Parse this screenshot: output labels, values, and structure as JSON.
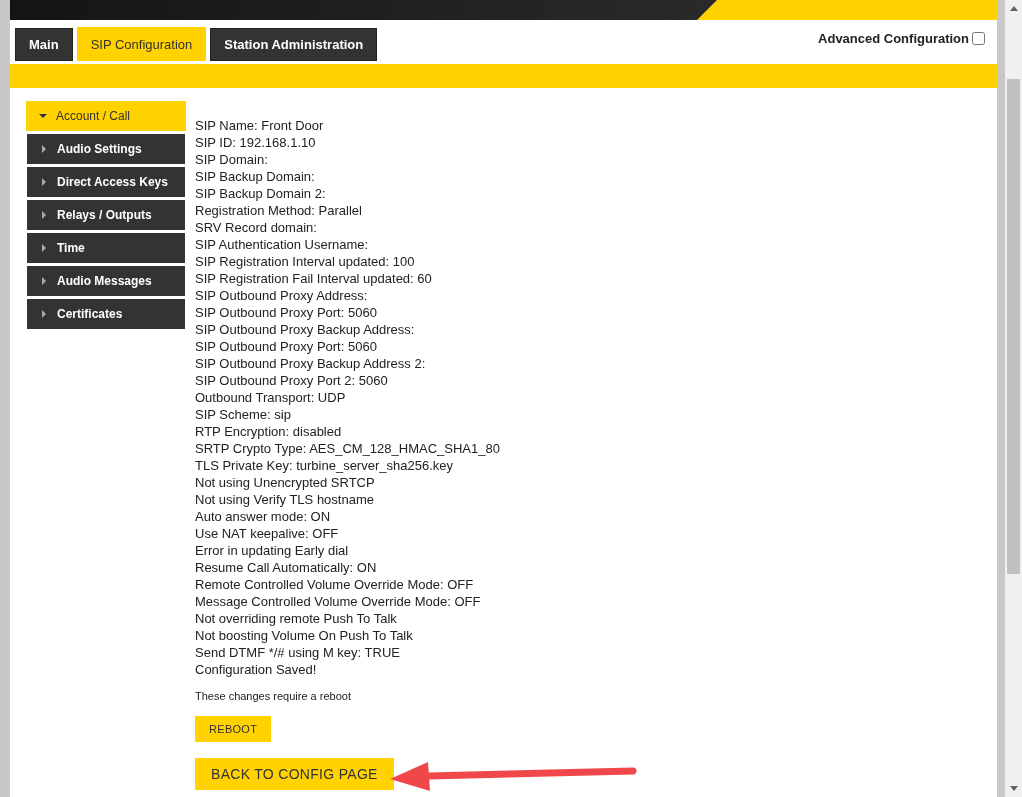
{
  "tabs": [
    {
      "label": "Main",
      "selected": false
    },
    {
      "label": "SIP Configuration",
      "selected": true
    },
    {
      "label": "Station Administration",
      "selected": false
    }
  ],
  "advanced_configuration": {
    "label": "Advanced Configuration",
    "checked": false
  },
  "sidebar": {
    "items": [
      {
        "label": "Account / Call",
        "expanded": true,
        "selected": true
      },
      {
        "label": "Audio Settings",
        "expanded": false,
        "selected": false
      },
      {
        "label": "Direct Access Keys",
        "expanded": false,
        "selected": false
      },
      {
        "label": "Relays / Outputs",
        "expanded": false,
        "selected": false
      },
      {
        "label": "Time",
        "expanded": false,
        "selected": false
      },
      {
        "label": "Audio Messages",
        "expanded": false,
        "selected": false
      },
      {
        "label": "Certificates",
        "expanded": false,
        "selected": false
      }
    ]
  },
  "messages": [
    "SIP Name: Front Door",
    "SIP ID: 192.168.1.10",
    "SIP Domain:",
    "SIP Backup Domain:",
    "SIP Backup Domain 2:",
    "Registration Method: Parallel",
    "SRV Record domain:",
    "SIP Authentication Username:",
    "SIP Registration Interval updated: 100",
    "SIP Registration Fail Interval updated: 60",
    "SIP Outbound Proxy Address:",
    "SIP Outbound Proxy Port: 5060",
    "SIP Outbound Proxy Backup Address:",
    "SIP Outbound Proxy Port: 5060",
    "SIP Outbound Proxy Backup Address 2:",
    "SIP Outbound Proxy Port 2: 5060",
    "Outbound Transport: UDP",
    "SIP Scheme: sip",
    "RTP Encryption: disabled",
    "SRTP Crypto Type: AES_CM_128_HMAC_SHA1_80",
    "TLS Private Key: turbine_server_sha256.key",
    "Not using Unencrypted SRTCP",
    "Not using Verify TLS hostname",
    "Auto answer mode: ON",
    "Use NAT keepalive: OFF",
    "Error in updating Early dial",
    "Resume Call Automatically: ON",
    "Remote Controlled Volume Override Mode: OFF",
    "Message Controlled Volume Override Mode: OFF",
    "Not overriding remote Push To Talk",
    "Not boosting Volume On Push To Talk",
    "Send DTMF */# using M key: TRUE",
    "Configuration Saved!"
  ],
  "reboot_notice": "These changes require a reboot",
  "buttons": [
    {
      "label": "REBOOT",
      "kind": "small"
    },
    {
      "label": "BACK TO CONFIG PAGE",
      "kind": "large"
    }
  ]
}
